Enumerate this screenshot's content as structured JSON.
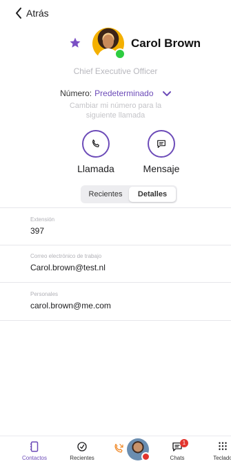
{
  "nav": {
    "back_label": "Atrás"
  },
  "contact": {
    "name": "Carol Brown",
    "job_title": "Chief Executive Officer",
    "presence_color": "#2ecc40",
    "favorite": true
  },
  "number": {
    "label": "Número:",
    "value": "Predeterminado",
    "hint": "Cambiar mi número para la siguiente llamada"
  },
  "actions": {
    "call_label": "Llamada",
    "message_label": "Mensaje"
  },
  "segments": {
    "recent": "Recientes",
    "details": "Detalles",
    "selected": "Detalles"
  },
  "fields": [
    {
      "label": "Extensión",
      "value": "397"
    },
    {
      "label": "Correo electrónico de trabajo",
      "value": "Carol.brown@test.nl"
    },
    {
      "label": "Personales",
      "value": "carol.brown@me.com"
    }
  ],
  "tabbar": {
    "contacts": "Contactos",
    "recents": "Recientes",
    "chats": "Chats",
    "chats_badge": "1",
    "keypad": "Teclado",
    "active": "Contactos"
  },
  "colors": {
    "accent": "#6c4bb8",
    "badge": "#e2352e",
    "call_orange": "#f08a2a"
  }
}
